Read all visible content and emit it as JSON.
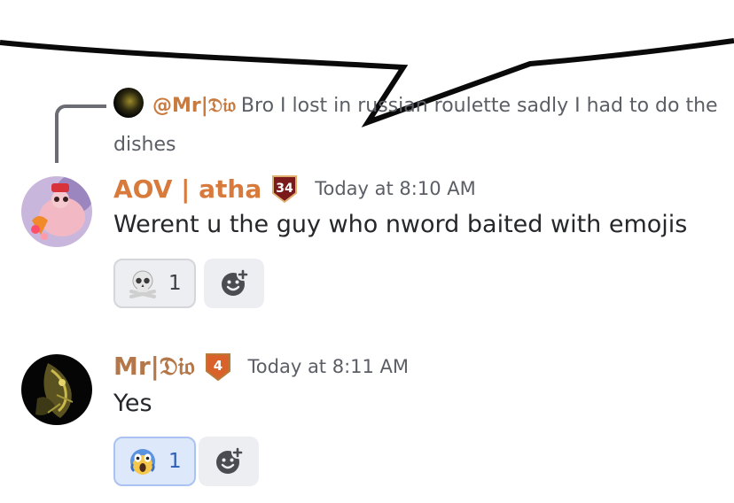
{
  "reply": {
    "mention": "@Mr|𝔇𝔦𝔬",
    "text": "Bro I lost in russian roulette sadly I had to do the dishes"
  },
  "messages": [
    {
      "username": "AOV | atha",
      "badge_level": "34",
      "timestamp": "Today at 8:10 AM",
      "text": "Werent u the guy who nword baited with emojis",
      "reactions": [
        {
          "emoji": "skull-and-crossbones-icon",
          "count": "1",
          "active": false
        }
      ]
    },
    {
      "username": "Mr|𝔇𝔦𝔬",
      "badge_level": "4",
      "timestamp": "Today at 8:11 AM",
      "text": "Yes",
      "reactions": [
        {
          "emoji": "screaming-face-icon",
          "count": "1",
          "active": true
        }
      ]
    }
  ],
  "colors": {
    "username_atha": "#d87a3c",
    "username_dio": "#b4774a",
    "reaction_active_bg": "#dde8fb",
    "reaction_active_border": "#aac3f2"
  }
}
